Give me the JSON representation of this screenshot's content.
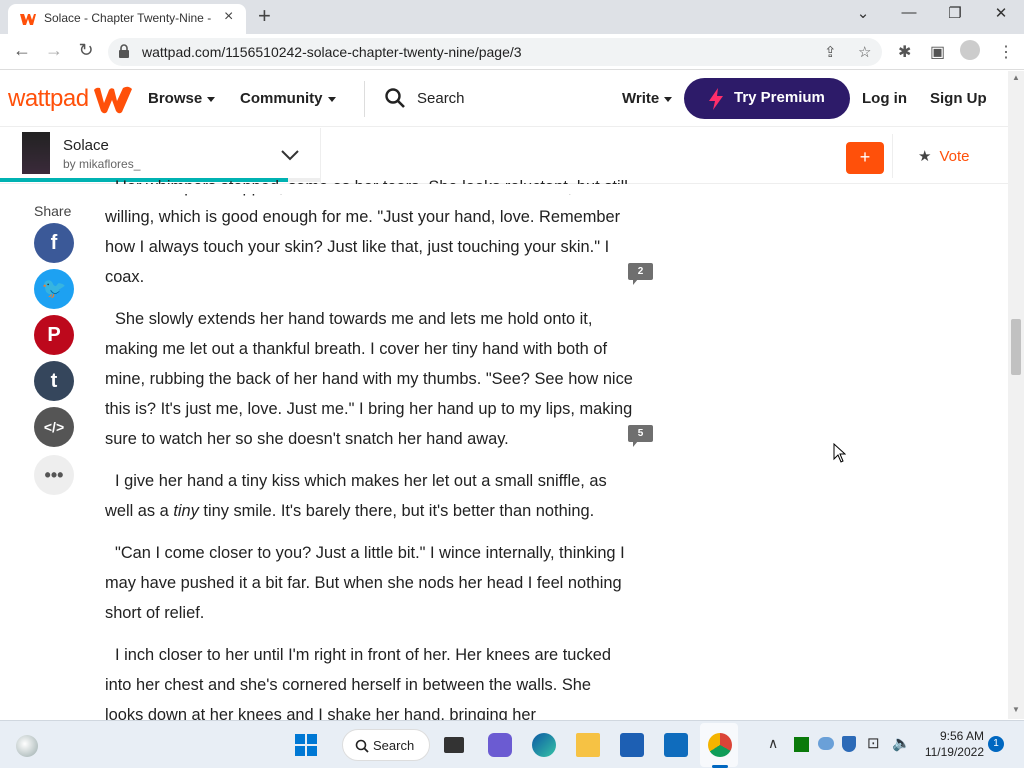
{
  "browser": {
    "tab_title": "Solace - Chapter Twenty-Nine - Wattpad",
    "url": "wattpad.com/1156510242-solace-chapter-twenty-nine/page/3"
  },
  "header": {
    "logo_text": "wattpad",
    "browse": "Browse",
    "community": "Community",
    "search": "Search",
    "write": "Write",
    "premium": "Try Premium",
    "login": "Log in",
    "signup": "Sign Up",
    "brand_color": "#ff500a",
    "premium_color": "#2d1b69"
  },
  "story": {
    "title": "Solace",
    "author": "by mikaflores_",
    "add_label": "+",
    "vote_label": "Vote",
    "progress": 0.9
  },
  "share": {
    "label": "Share",
    "buttons": [
      {
        "name": "facebook-icon",
        "color": "#3b5998"
      },
      {
        "name": "twitter-icon",
        "color": "#1da1f2"
      },
      {
        "name": "pinterest-icon",
        "color": "#bd081c"
      },
      {
        "name": "tumblr-icon",
        "color": "#35465c"
      },
      {
        "name": "embed-icon",
        "color": "#555555"
      },
      {
        "name": "more-icon",
        "color": "#eeeeee"
      }
    ]
  },
  "content": {
    "p1": "Her whimpers stopped, same as her tears. She looks reluctant, but still willing, which is good enough for me. \"Just your hand, love. Remember how I always touch your skin? Just like that, just touching your skin.\" I coax.",
    "p2": "She slowly extends her hand towards me and lets me hold onto it, making me let out a thankful breath. I cover her tiny hand with both of mine, rubbing the back of her hand with my thumbs. \"See? See how nice this is? It's just me, love. Just me.\" I bring her hand up to my lips, making sure to watch her so she doesn't snatch her hand away.",
    "p3_a": "I give her hand a tiny kiss which makes her let out a small sniffle, as well as a ",
    "p3_em": "tiny",
    "p3_b": " tiny smile. It's barely there, but it's better than nothing.",
    "p4": "\"Can I come closer to you? Just a little bit.\" I wince internally, thinking I may have pushed it a bit far. But when she nods her head I feel nothing short of relief.",
    "p5": "I inch closer to her until I'm right in front of her. Her knees are tucked into her chest and she's cornered herself in between the walls. She looks down at her knees and I shake her hand, bringing her",
    "comments": [
      "2",
      "5"
    ]
  },
  "taskbar": {
    "search": "Search",
    "time": "9:56 AM",
    "date": "11/19/2022",
    "notifications": "1"
  }
}
